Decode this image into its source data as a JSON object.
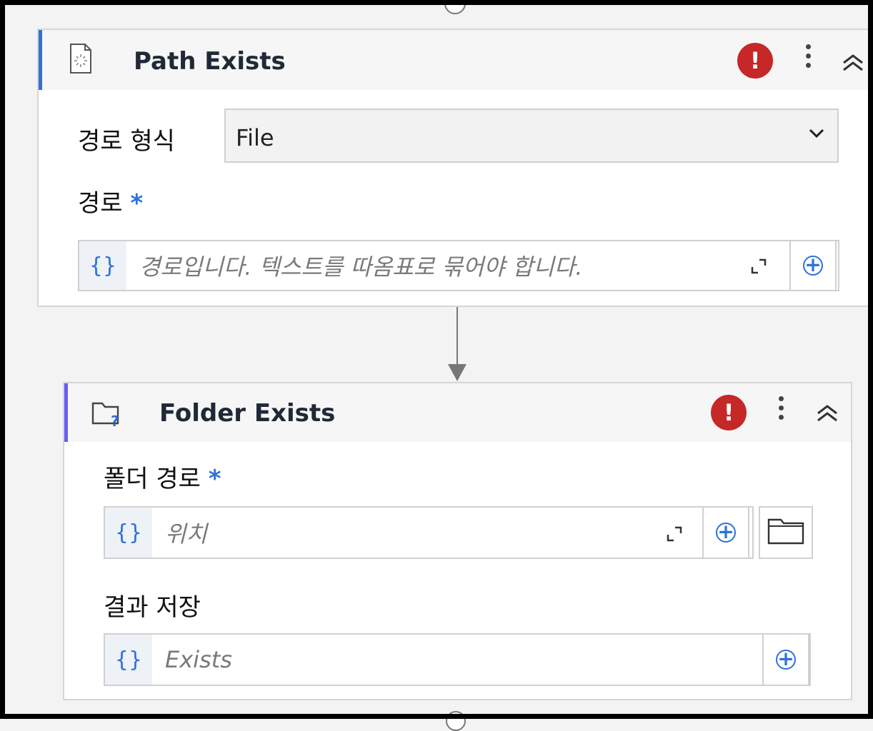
{
  "path_exists": {
    "title": "Path Exists",
    "path_type_label": "경로 형식",
    "path_type_value": "File",
    "path_label": "경로",
    "required_mark": "*",
    "path_placeholder": "경로입니다. 텍스트를 따옴표로 묶어야 합니다.",
    "error_mark": "!"
  },
  "folder_exists": {
    "title": "Folder Exists",
    "folder_path_label": "폴더 경로",
    "required_mark": "*",
    "folder_path_placeholder": "위치",
    "save_result_label": "결과 저장",
    "save_result_placeholder": "Exists",
    "error_mark": "!"
  },
  "icons": {
    "braces": "{}",
    "plus": "+",
    "chevron": "⌄"
  },
  "colors": {
    "accent": "#2d72d9",
    "error": "#c62828",
    "folder_accent": "#6a5cf5"
  }
}
